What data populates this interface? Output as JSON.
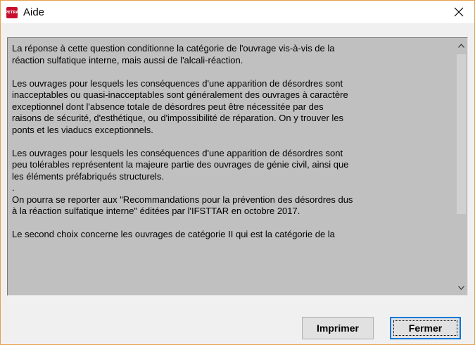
{
  "window": {
    "title": "Aide",
    "app_icon_text": "PETRA"
  },
  "help_text": {
    "paragraphs": [
      {
        "lines": [
          "La réponse à cette question conditionne la catégorie de l'ouvrage vis-à-vis de la",
          "réaction sulfatique interne, mais aussi de l'alcali-réaction."
        ]
      },
      {
        "lines": [
          "Les ouvrages pour lesquels les conséquences d'une apparition de désordres sont",
          "inacceptables ou quasi-inacceptables sont généralement des ouvrages à caractère",
          "exceptionnel dont l'absence totale de désordres peut être nécessitée par des",
          "raisons de sécurité, d'esthétique, ou d'impossibilité de réparation. On y trouver les",
          "ponts et les viaducs exceptionnels."
        ]
      },
      {
        "lines": [
          "Les ouvrages pour lesquels les conséquences d'une apparition de désordres sont",
          "peu tolérables représentent la majeure partie des ouvrages de génie civil, ainsi que",
          "les éléments préfabriqués structurels.",
          ".",
          "On pourra se reporter aux \"Recommandations pour la prévention des désordres dus",
          "à la réaction sulfatique interne\" éditées par l'IFSTTAR en octobre 2017."
        ]
      },
      {
        "lines": [
          "Le second choix concerne les ouvrages de catégorie II qui est la catégorie de la"
        ]
      }
    ]
  },
  "buttons": {
    "print_label": "Imprimer",
    "close_label": "Fermer"
  }
}
